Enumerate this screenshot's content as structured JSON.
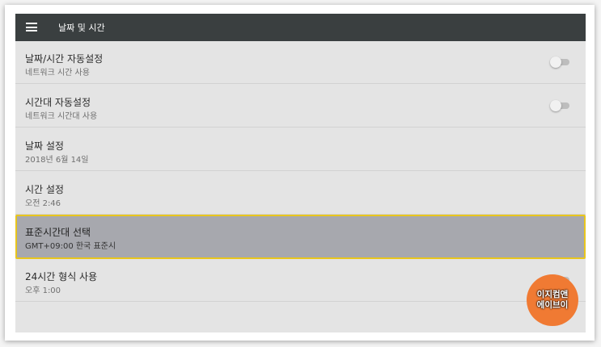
{
  "toolbar": {
    "title": "날짜 및 시간",
    "menu_icon": "hamburger-menu-icon"
  },
  "rows": [
    {
      "title": "날짜/시간 자동설정",
      "subtitle": "네트워크 시간 사용",
      "toggle_on": false
    },
    {
      "title": "시간대 자동설정",
      "subtitle": "네트워크 시간대 사용",
      "toggle_on": false
    },
    {
      "title": "날짜 설정",
      "subtitle": "2018년 6월 14일"
    },
    {
      "title": "시간 설정",
      "subtitle": "오전 2:46"
    },
    {
      "title": "표준시간대 선택",
      "subtitle": "GMT+09:00 한국 표준시",
      "selected": true
    },
    {
      "title": "24시간 형식 사용",
      "subtitle": "오후 1:00",
      "toggle_on": false
    }
  ],
  "watermark": {
    "line1": "이지컴앤",
    "line2": "에이브이"
  },
  "colors": {
    "toolbar": "#3a3f40",
    "background": "#e4e4e4",
    "selected_row": "#a7a8ae",
    "selected_border": "#e8c51d",
    "watermark": "#f07a33"
  }
}
